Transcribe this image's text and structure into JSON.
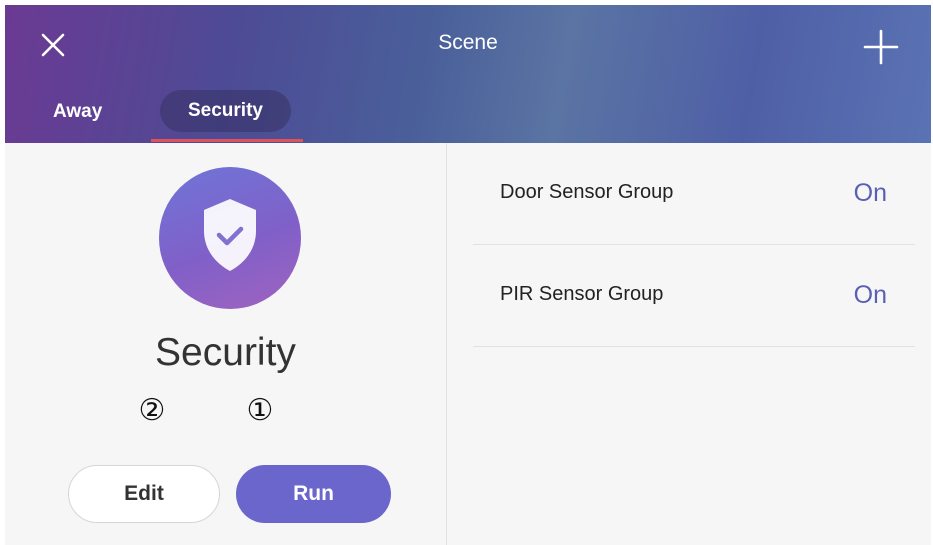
{
  "header": {
    "title": "Scene",
    "close_icon": "close-icon",
    "add_icon": "plus-icon",
    "gradient_colors": [
      "#6b3a93",
      "#4a5f9a",
      "#5a73b4"
    ]
  },
  "tabs": [
    {
      "label": "Away",
      "selected": false
    },
    {
      "label": "Security",
      "selected": true
    }
  ],
  "tab_indicator_color": "#e0525a",
  "scene": {
    "icon": "shield-check-icon",
    "name": "Security",
    "icon_colors": [
      "#6f75d8",
      "#a063c0"
    ]
  },
  "markers": {
    "edit_marker": "②",
    "run_marker": "①"
  },
  "actions": {
    "edit_label": "Edit",
    "run_label": "Run",
    "run_color": "#6a66cc"
  },
  "devices": [
    {
      "name": "Door Sensor Group",
      "state": "On"
    },
    {
      "name": "PIR Sensor Group",
      "state": "On"
    }
  ],
  "accent_color": "#5a5fb4"
}
